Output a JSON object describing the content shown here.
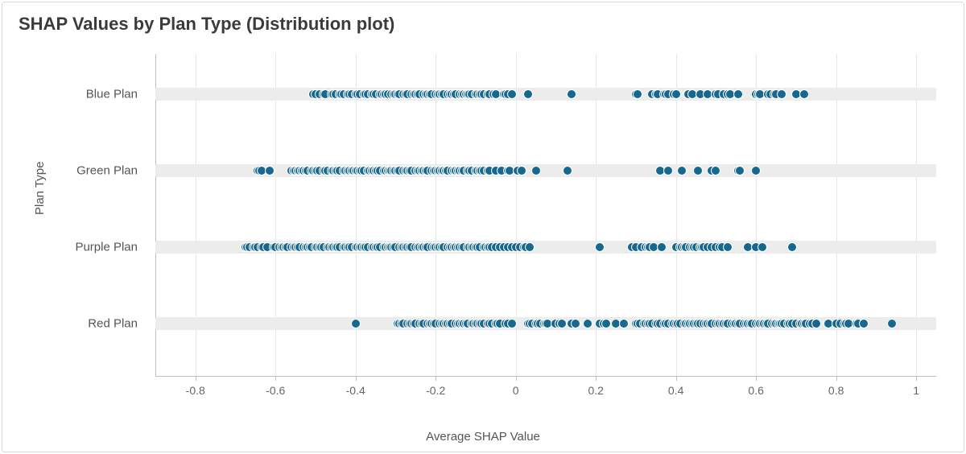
{
  "title": "SHAP Values by Plan Type (Distribution plot)",
  "xlabel": "Average SHAP Value",
  "ylabel": "Plan Type",
  "x_ticks": [
    -0.8,
    -0.6,
    -0.4,
    -0.2,
    0,
    0.2,
    0.4,
    0.6,
    0.8,
    1
  ],
  "x_domain": [
    -0.9,
    1.05
  ],
  "categories": [
    "Blue Plan",
    "Green Plan",
    "Purple Plan",
    "Red Plan"
  ],
  "dot_color": "#17688f",
  "chart_data": {
    "type": "scatter",
    "title": "SHAP Values by Plan Type (Distribution plot)",
    "xlabel": "Average SHAP Value",
    "ylabel": "Plan Type",
    "xlim": [
      -0.9,
      1.05
    ],
    "series": [
      {
        "name": "Blue Plan",
        "values": [
          -0.505,
          -0.5,
          -0.49,
          -0.48,
          -0.475,
          -0.46,
          -0.455,
          -0.45,
          -0.44,
          -0.435,
          -0.43,
          -0.42,
          -0.415,
          -0.41,
          -0.4,
          -0.395,
          -0.39,
          -0.38,
          -0.375,
          -0.37,
          -0.36,
          -0.355,
          -0.35,
          -0.34,
          -0.335,
          -0.33,
          -0.325,
          -0.32,
          -0.31,
          -0.305,
          -0.3,
          -0.295,
          -0.29,
          -0.28,
          -0.275,
          -0.27,
          -0.26,
          -0.255,
          -0.25,
          -0.245,
          -0.24,
          -0.23,
          -0.225,
          -0.22,
          -0.215,
          -0.21,
          -0.2,
          -0.195,
          -0.19,
          -0.185,
          -0.18,
          -0.17,
          -0.165,
          -0.16,
          -0.155,
          -0.15,
          -0.14,
          -0.135,
          -0.13,
          -0.125,
          -0.12,
          -0.115,
          -0.11,
          -0.1,
          -0.095,
          -0.09,
          -0.085,
          -0.08,
          -0.07,
          -0.065,
          -0.055,
          -0.05,
          -0.03,
          -0.025,
          -0.02,
          -0.01,
          0.03,
          0.14,
          0.3,
          0.305,
          0.34,
          0.35,
          0.355,
          0.37,
          0.375,
          0.38,
          0.395,
          0.4,
          0.43,
          0.44,
          0.46,
          0.48,
          0.5,
          0.505,
          0.52,
          0.53,
          0.535,
          0.555,
          0.6,
          0.605,
          0.61,
          0.63,
          0.635,
          0.645,
          0.65,
          0.665,
          0.7,
          0.72
        ]
      },
      {
        "name": "Green Plan",
        "values": [
          -0.645,
          -0.64,
          -0.635,
          -0.615,
          -0.56,
          -0.555,
          -0.55,
          -0.545,
          -0.54,
          -0.535,
          -0.53,
          -0.525,
          -0.52,
          -0.51,
          -0.505,
          -0.5,
          -0.495,
          -0.49,
          -0.48,
          -0.475,
          -0.47,
          -0.46,
          -0.455,
          -0.45,
          -0.445,
          -0.44,
          -0.43,
          -0.425,
          -0.42,
          -0.415,
          -0.41,
          -0.405,
          -0.4,
          -0.395,
          -0.39,
          -0.385,
          -0.38,
          -0.37,
          -0.365,
          -0.36,
          -0.355,
          -0.35,
          -0.345,
          -0.34,
          -0.33,
          -0.325,
          -0.32,
          -0.315,
          -0.31,
          -0.305,
          -0.3,
          -0.295,
          -0.29,
          -0.28,
          -0.275,
          -0.27,
          -0.265,
          -0.26,
          -0.25,
          -0.245,
          -0.24,
          -0.235,
          -0.23,
          -0.225,
          -0.22,
          -0.21,
          -0.205,
          -0.2,
          -0.195,
          -0.19,
          -0.185,
          -0.18,
          -0.175,
          -0.17,
          -0.16,
          -0.155,
          -0.15,
          -0.145,
          -0.14,
          -0.135,
          -0.13,
          -0.12,
          -0.115,
          -0.11,
          -0.1,
          -0.095,
          -0.09,
          -0.085,
          -0.08,
          -0.07,
          -0.065,
          -0.05,
          -0.035,
          -0.02,
          -0.015,
          0.005,
          0.015,
          0.05,
          0.13,
          0.36,
          0.38,
          0.415,
          0.455,
          0.49,
          0.5,
          0.555,
          0.56,
          0.6
        ]
      },
      {
        "name": "Purple Plan",
        "values": [
          -0.675,
          -0.67,
          -0.665,
          -0.655,
          -0.65,
          -0.645,
          -0.635,
          -0.63,
          -0.62,
          -0.605,
          -0.6,
          -0.59,
          -0.585,
          -0.58,
          -0.575,
          -0.57,
          -0.56,
          -0.555,
          -0.55,
          -0.545,
          -0.54,
          -0.53,
          -0.525,
          -0.52,
          -0.515,
          -0.51,
          -0.5,
          -0.495,
          -0.49,
          -0.485,
          -0.48,
          -0.47,
          -0.465,
          -0.46,
          -0.455,
          -0.45,
          -0.445,
          -0.44,
          -0.43,
          -0.425,
          -0.42,
          -0.415,
          -0.41,
          -0.4,
          -0.395,
          -0.39,
          -0.385,
          -0.38,
          -0.375,
          -0.37,
          -0.36,
          -0.355,
          -0.35,
          -0.345,
          -0.34,
          -0.33,
          -0.325,
          -0.32,
          -0.315,
          -0.31,
          -0.305,
          -0.3,
          -0.29,
          -0.285,
          -0.28,
          -0.275,
          -0.27,
          -0.265,
          -0.26,
          -0.25,
          -0.245,
          -0.24,
          -0.235,
          -0.23,
          -0.225,
          -0.22,
          -0.21,
          -0.205,
          -0.2,
          -0.195,
          -0.19,
          -0.185,
          -0.18,
          -0.17,
          -0.165,
          -0.16,
          -0.155,
          -0.15,
          -0.145,
          -0.14,
          -0.135,
          -0.13,
          -0.12,
          -0.115,
          -0.11,
          -0.105,
          -0.1,
          -0.095,
          -0.09,
          -0.08,
          -0.075,
          -0.07,
          -0.065,
          -0.06,
          -0.05,
          -0.04,
          -0.03,
          -0.02,
          -0.01,
          0.0,
          0.01,
          0.02,
          0.025,
          0.035,
          0.21,
          0.29,
          0.3,
          0.315,
          0.325,
          0.33,
          0.335,
          0.345,
          0.365,
          0.4,
          0.41,
          0.415,
          0.42,
          0.425,
          0.435,
          0.44,
          0.445,
          0.45,
          0.46,
          0.465,
          0.47,
          0.48,
          0.49,
          0.5,
          0.51,
          0.515,
          0.53,
          0.58,
          0.6,
          0.615,
          0.69
        ]
      },
      {
        "name": "Red Plan",
        "values": [
          -0.4,
          -0.295,
          -0.29,
          -0.285,
          -0.28,
          -0.27,
          -0.265,
          -0.26,
          -0.255,
          -0.25,
          -0.24,
          -0.235,
          -0.23,
          -0.22,
          -0.215,
          -0.21,
          -0.205,
          -0.2,
          -0.19,
          -0.185,
          -0.18,
          -0.175,
          -0.17,
          -0.165,
          -0.16,
          -0.15,
          -0.145,
          -0.14,
          -0.135,
          -0.13,
          -0.125,
          -0.12,
          -0.11,
          -0.105,
          -0.1,
          -0.095,
          -0.09,
          -0.085,
          -0.08,
          -0.07,
          -0.065,
          -0.06,
          -0.05,
          -0.045,
          -0.04,
          -0.025,
          -0.02,
          -0.01,
          0.03,
          0.035,
          0.04,
          0.05,
          0.055,
          0.06,
          0.07,
          0.075,
          0.08,
          0.1,
          0.11,
          0.115,
          0.14,
          0.15,
          0.18,
          0.21,
          0.22,
          0.225,
          0.25,
          0.27,
          0.3,
          0.305,
          0.31,
          0.32,
          0.325,
          0.33,
          0.335,
          0.34,
          0.35,
          0.355,
          0.36,
          0.37,
          0.375,
          0.38,
          0.39,
          0.395,
          0.4,
          0.405,
          0.41,
          0.42,
          0.425,
          0.43,
          0.435,
          0.44,
          0.445,
          0.45,
          0.455,
          0.46,
          0.47,
          0.475,
          0.48,
          0.485,
          0.49,
          0.5,
          0.505,
          0.51,
          0.515,
          0.52,
          0.525,
          0.53,
          0.54,
          0.545,
          0.55,
          0.555,
          0.56,
          0.57,
          0.575,
          0.58,
          0.585,
          0.59,
          0.6,
          0.605,
          0.61,
          0.615,
          0.62,
          0.625,
          0.63,
          0.64,
          0.645,
          0.65,
          0.655,
          0.66,
          0.665,
          0.67,
          0.68,
          0.685,
          0.69,
          0.7,
          0.71,
          0.715,
          0.72,
          0.725,
          0.735,
          0.74,
          0.75,
          0.78,
          0.8,
          0.81,
          0.82,
          0.825,
          0.83,
          0.85,
          0.855,
          0.87,
          0.94
        ]
      }
    ]
  }
}
